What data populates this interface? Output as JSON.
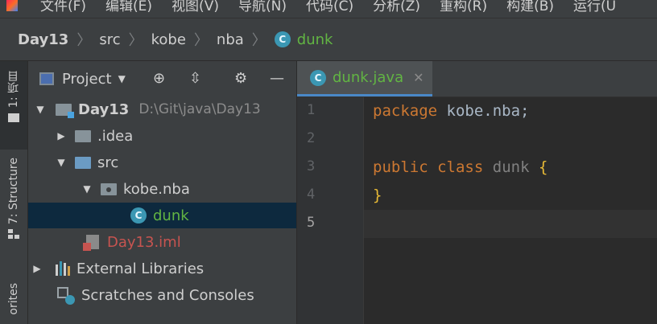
{
  "menubar": {
    "items": [
      "文件(F)",
      "编辑(E)",
      "视图(V)",
      "导航(N)",
      "代码(C)",
      "分析(Z)",
      "重构(R)",
      "构建(B)",
      "运行(U"
    ]
  },
  "breadcrumb": {
    "items": [
      "Day13",
      "src",
      "kobe",
      "nba",
      "dunk"
    ],
    "file_icon_letter": "C"
  },
  "left_strip": {
    "project_tab": "1: 项目",
    "structure_tab": "7: Structure",
    "favorites_tab": "orites"
  },
  "project_panel": {
    "title": "Project",
    "tree": [
      {
        "label": "Day13",
        "path": "D:\\Git\\java\\Day13",
        "state": "expanded"
      },
      {
        "label": ".idea",
        "state": "collapsed"
      },
      {
        "label": "src",
        "state": "expanded"
      },
      {
        "label": "kobe.nba",
        "state": "expanded"
      },
      {
        "label": "dunk",
        "icon_letter": "C",
        "selected": true
      },
      {
        "label": "Day13.iml"
      },
      {
        "label": "External Libraries",
        "state": "collapsed"
      },
      {
        "label": "Scratches and Consoles"
      }
    ]
  },
  "editor": {
    "tab": {
      "label": "dunk.java",
      "icon_letter": "C",
      "close": "✕"
    },
    "line_numbers": [
      "1",
      "2",
      "3",
      "4",
      "5"
    ],
    "code": {
      "line1_kw": "package",
      "line1_rest": " kobe.nba;",
      "line3_kw1": "public",
      "line3_kw2": "class",
      "line3_name": "dunk",
      "line3_brace": "{",
      "line4_brace": "}"
    }
  },
  "colors": {
    "keyword": "#cc7832",
    "brace": "#e8ba36",
    "java_class_icon": "#3b97b3",
    "selection": "#0d293e"
  }
}
